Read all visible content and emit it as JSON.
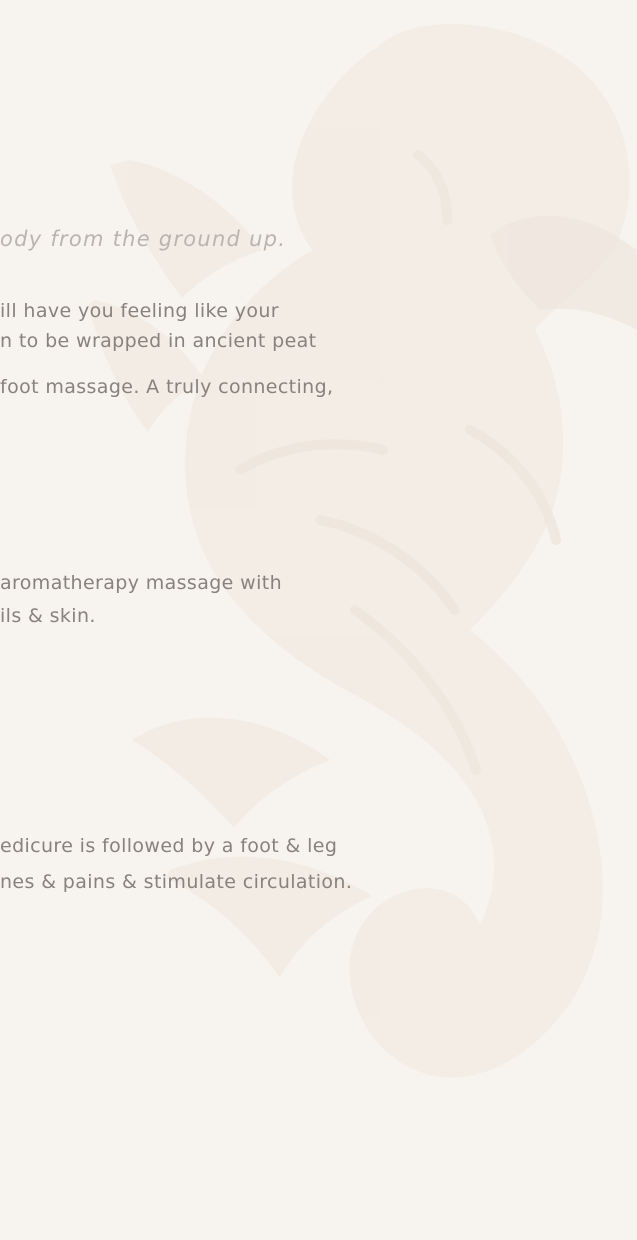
{
  "treatment_1": {
    "tagline": "ody from the ground up.",
    "lines": [
      "ill have you feeling like your",
      "n to be wrapped in ancient peat",
      "foot massage. A truly connecting,"
    ]
  },
  "treatment_2": {
    "lines": [
      " aromatherapy massage with",
      "ils & skin."
    ]
  },
  "treatment_3": {
    "lines": [
      "edicure is followed by a foot & leg",
      "nes & pains & stimulate circulation."
    ]
  },
  "colors": {
    "background": "#f7f3ee",
    "watermark": "#f2ebe3",
    "text": "#87827d",
    "tagline_text": "#b9b4af"
  },
  "icons": {
    "watermark": "griffin-crest-icon"
  }
}
